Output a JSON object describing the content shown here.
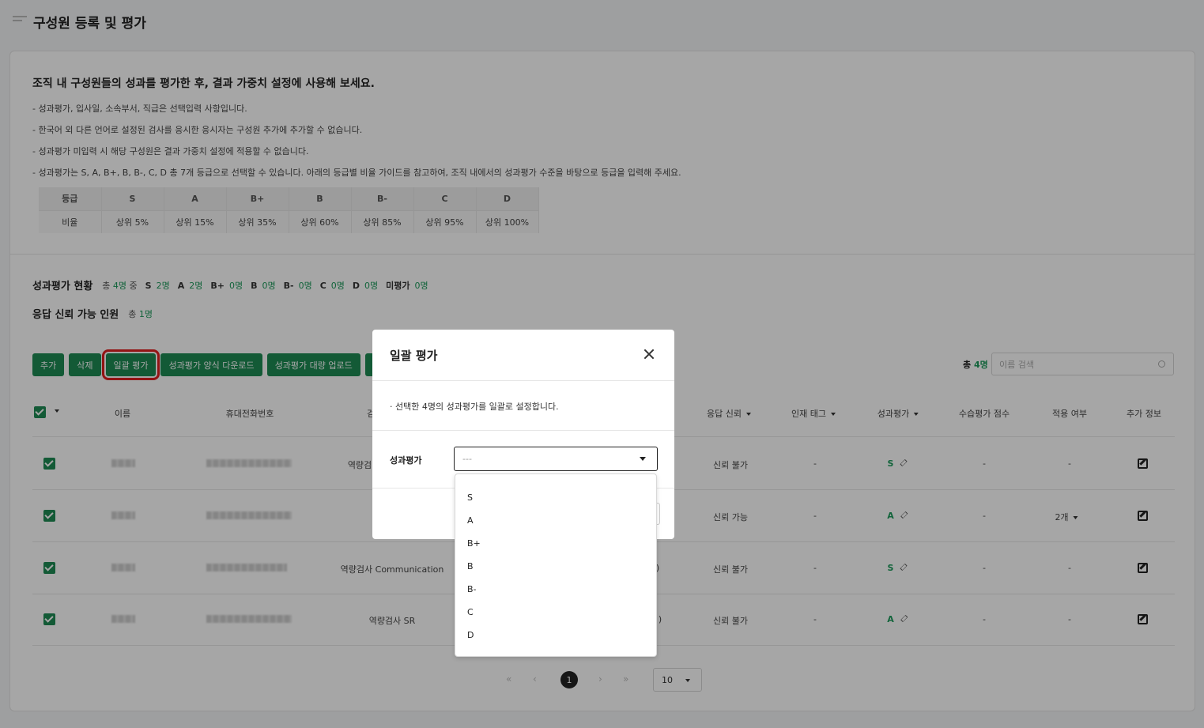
{
  "header": {
    "title": "구성원 등록 및 평가"
  },
  "intro": {
    "title": "조직 내 구성원들의 성과를 평가한 후, 결과 가중치 설정에 사용해 보세요.",
    "lines": [
      "- 성과평가, 입사일, 소속부서, 직급은 선택입력 사항입니다.",
      "- 한국어 외 다른 언어로 설정된 검사를 응시한 응시자는 구성원 추가에 추가할 수 없습니다.",
      "- 성과평가 미입력 시 해당 구성원은 결과 가중치 설정에 적용할 수 없습니다.",
      "- 성과평가는 S, A, B+, B, B-, C, D 총 7개 등급으로 선택할 수 있습니다. 아래의 등급별 비율 가이드를 참고하여, 조직 내에서의 성과평가 수준을 바탕으로 등급을 입력해 주세요."
    ]
  },
  "grade_table": {
    "head": [
      "등급",
      "S",
      "A",
      "B+",
      "B",
      "B-",
      "C",
      "D"
    ],
    "body": [
      "비율",
      "상위 5%",
      "상위 15%",
      "상위 35%",
      "상위 60%",
      "상위 85%",
      "상위 95%",
      "상위 100%"
    ]
  },
  "status": {
    "title": "성과평가 현황",
    "total_prefix": "총",
    "total_num": "4명",
    "total_suffix": "중",
    "items": [
      {
        "label": "S",
        "count": "2명"
      },
      {
        "label": "A",
        "count": "2명"
      },
      {
        "label": "B+",
        "count": "0명"
      },
      {
        "label": "B",
        "count": "0명"
      },
      {
        "label": "B-",
        "count": "0명"
      },
      {
        "label": "C",
        "count": "0명"
      },
      {
        "label": "D",
        "count": "0명"
      },
      {
        "label": "미평가",
        "count": "0명"
      }
    ],
    "reliable_title": "응답 신뢰 가능 인원",
    "reliable_prefix": "총",
    "reliable_count": "1명"
  },
  "toolbar": {
    "add": "추가",
    "delete": "삭제",
    "bulk_eval": "일괄 평가",
    "download_form": "성과평가 양식 다운로드",
    "bulk_upload": "성과평가 대량 업로드",
    "next_partial": "구",
    "total_label": "총",
    "total_count": "4명",
    "search_placeholder": "이름 검색"
  },
  "table": {
    "headers": {
      "name": "이름",
      "phone": "휴대전화번호",
      "test_partial": "검",
      "reliability": "응답 신뢰",
      "talent_tag": "인재 태그",
      "evaluation": "성과평가",
      "train_score": "수습평가 점수",
      "applied": "적용 여부",
      "extra": "추가 정보"
    },
    "rows": [
      {
        "test": "역량검",
        "reliability": "신뢰 불가",
        "tag": "-",
        "grade": "S",
        "train": "-",
        "applied": "-"
      },
      {
        "test": "",
        "reliability": "신뢰 가능",
        "tag": "-",
        "grade": "A",
        "train": "-",
        "applied": "2개"
      },
      {
        "test": "역량검사 Communication",
        "tag_partial": ")",
        "reliability": "신뢰 불가",
        "tag": "-",
        "grade": "S",
        "train": "-",
        "applied": "-"
      },
      {
        "test": "역량검사 SR",
        "tag_partial": ")",
        "reliability": "신뢰 불가",
        "tag": "-",
        "grade": "A",
        "train": "-",
        "applied": "-"
      }
    ]
  },
  "pagination": {
    "first": "«",
    "prev": "‹",
    "current": "1",
    "next": "›",
    "last": "»",
    "page_size": "10"
  },
  "modal": {
    "title": "일괄 평가",
    "description": "·  선택한 4명의 성과평가를 일괄로 설정합니다.",
    "field_label": "성과평가",
    "select_value": "---",
    "options": [
      "S",
      "A",
      "B+",
      "B",
      "B-",
      "C",
      "D"
    ]
  },
  "colors": {
    "brand": "#1e8a54",
    "accent_text": "#1d9a5b",
    "highlight": "#e02020"
  }
}
